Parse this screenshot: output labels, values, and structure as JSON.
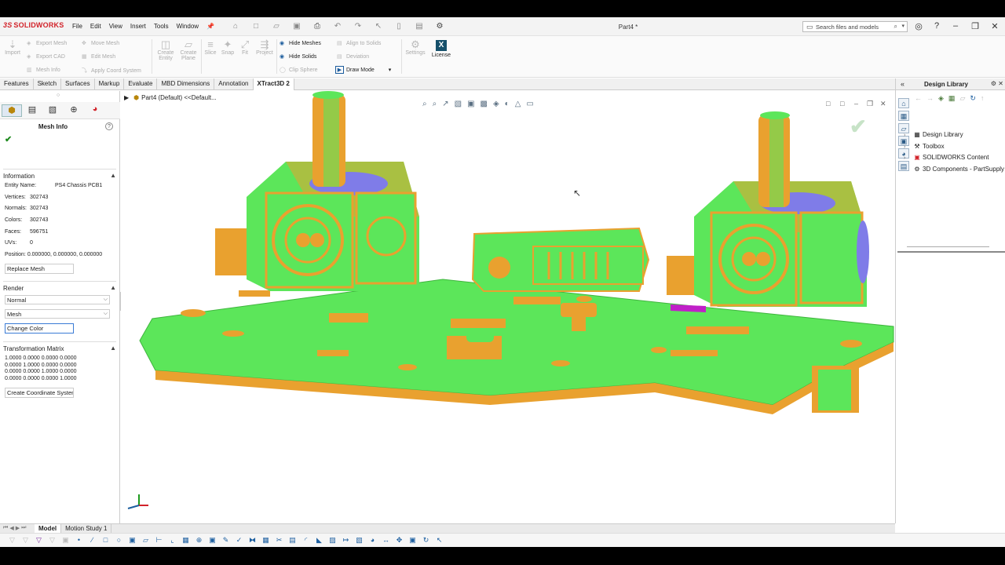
{
  "app": {
    "brand": "SOLIDWORKS",
    "brand_prefix": "3S",
    "document_title": "Part4 *"
  },
  "menu": [
    "File",
    "Edit",
    "View",
    "Insert",
    "Tools",
    "Window"
  ],
  "search": {
    "placeholder": "Search files and models"
  },
  "ribbon": {
    "import": "Import",
    "export_mesh": "Export Mesh",
    "export_cad": "Export CAD",
    "mesh_info": "Mesh Info",
    "move_mesh": "Move Mesh",
    "edit_mesh": "Edit Mesh",
    "apply_coord": "Apply Coord System",
    "create_entity": "Create Entity",
    "create_plane": "Create Plane",
    "slice": "Slice",
    "snap": "Snap",
    "fit": "Fit",
    "project": "Project",
    "hide_meshes": "Hide Meshes",
    "hide_solids": "Hide Solids",
    "clip_sphere": "Clip Sphere",
    "align_to_solids": "Align to Solids",
    "deviation": "Deviation",
    "draw_mode": "Draw Mode",
    "settings": "Settings",
    "license": "License"
  },
  "tabs": [
    "Features",
    "Sketch",
    "Surfaces",
    "Markup",
    "Evaluate",
    "MBD Dimensions",
    "Annotation",
    "XTract3D 2"
  ],
  "active_tab": "XTract3D 2",
  "property_manager": {
    "title": "Mesh Info",
    "information_header": "Information",
    "entity_name_label": "Entity Name:",
    "entity_name": "PS4 Chassis PCB1",
    "vertices_label": "Vertices:",
    "vertices": "302743",
    "normals_label": "Normals:",
    "normals": "302743",
    "colors_label": "Colors:",
    "colors": "302743",
    "faces_label": "Faces:",
    "faces": "596751",
    "uvs_label": "UVs:",
    "uvs": "0",
    "position_label": "Position:",
    "position": "0.000000, 0.000000, 0.000000",
    "replace_mesh": "Replace Mesh",
    "render_header": "Render",
    "render_mode": "Normal",
    "render_display": "Mesh",
    "change_color": "Change Color",
    "transform_header": "Transformation Matrix",
    "matrix": "1.0000 0.0000 0.0000 0.0000\n0.0000 1.0000 0.0000 0.0000\n0.0000 0.0000 1.0000 0.0000\n0.0000 0.0000 0.0000 1.0000",
    "create_coord": "Create Coordinate Systen"
  },
  "feature_tree": {
    "root": "Part4 (Default) <<Default..."
  },
  "task_pane": {
    "title": "Design Library",
    "items": [
      "Design Library",
      "Toolbox",
      "SOLIDWORKS Content",
      "3D Components - PartSupply"
    ]
  },
  "bottom_tabs": [
    "Model",
    "Motion Study 1"
  ],
  "colors": {
    "brand_red": "#d2232a",
    "mesh_green": "#5ce65a",
    "mesh_orange": "#e9a12f",
    "mesh_blue": "#7f7ce8",
    "accent_blue": "#1a5b9c"
  }
}
